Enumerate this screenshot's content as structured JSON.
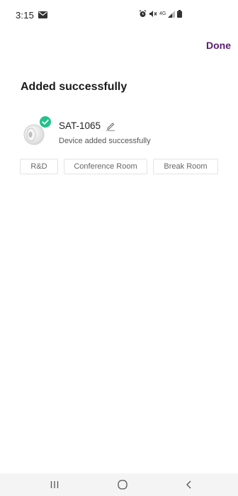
{
  "status_bar": {
    "time": "3:15",
    "network_label": "4G"
  },
  "header": {
    "done_label": "Done"
  },
  "page": {
    "title": "Added successfully"
  },
  "device": {
    "name": "SAT-1065",
    "status": "Device added successfully"
  },
  "rooms": [
    {
      "label": "R&D"
    },
    {
      "label": "Conference Room"
    },
    {
      "label": "Break Room"
    }
  ],
  "colors": {
    "accent": "#5b1c6e",
    "success": "#20c38a",
    "chip_border": "#e3e3e3",
    "nav_bar": "#f4f4f4"
  },
  "icons": [
    "mail-icon",
    "alarm-icon",
    "mute-icon",
    "signal-icon",
    "battery-icon",
    "check-icon",
    "edit-icon",
    "recents-icon",
    "home-icon",
    "back-icon"
  ]
}
